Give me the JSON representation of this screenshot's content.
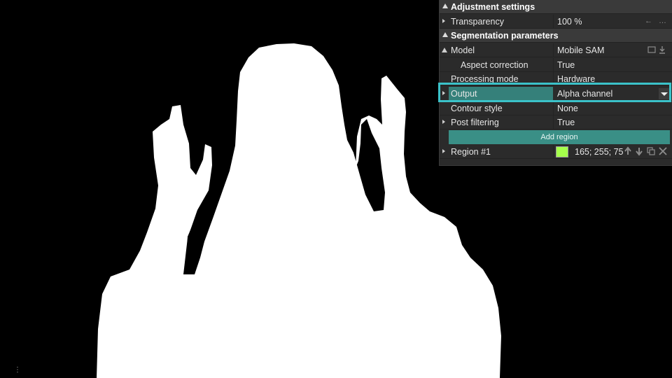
{
  "panel": {
    "sections": {
      "adjustment": "Adjustment settings",
      "segmentation": "Segmentation parameters"
    },
    "transparency": {
      "label": "Transparency",
      "value": "100 %",
      "icons": "← …"
    },
    "model": {
      "label": "Model",
      "value": "Mobile SAM"
    },
    "aspect_correction": {
      "label": "Aspect correction",
      "value": "True"
    },
    "processing_mode": {
      "label": "Processing mode",
      "value": "Hardware"
    },
    "output": {
      "label": "Output",
      "value": "Alpha channel"
    },
    "contour_style": {
      "label": "Contour style",
      "value": "None"
    },
    "post_filtering": {
      "label": "Post filtering",
      "value": "True"
    },
    "add_region_label": "Add region",
    "region": {
      "label": "Region #1",
      "value": "165; 255; 75",
      "color": "#a5ff4b"
    }
  },
  "colors": {
    "highlight": "#3bc2c9",
    "selection": "#35807a",
    "button": "#3a8f86"
  },
  "corner_dots": "⋮"
}
